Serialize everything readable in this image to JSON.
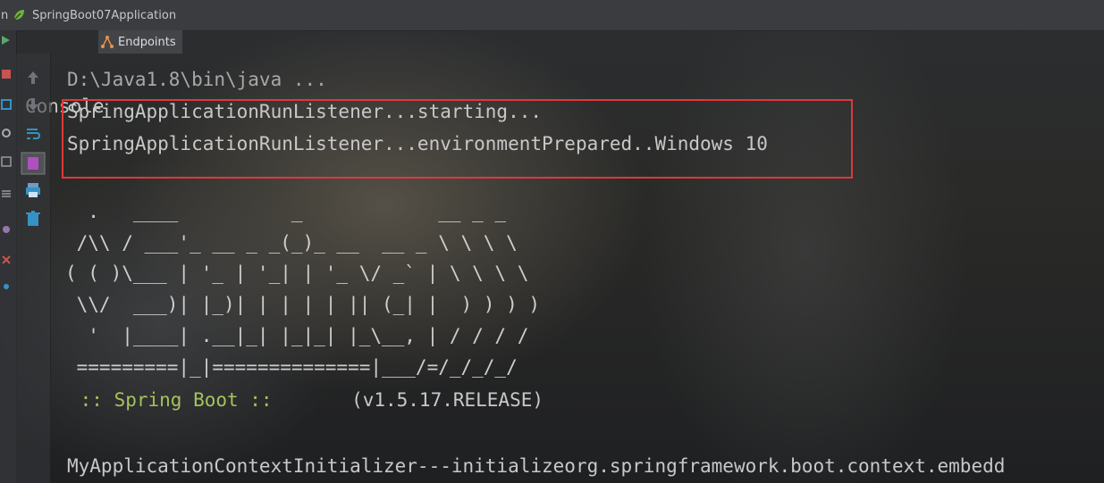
{
  "window": {
    "left_edge_text": "n",
    "title": "SpringBoot07Application"
  },
  "tabs": [
    {
      "label": "Console"
    },
    {
      "label": "Endpoints"
    }
  ],
  "console": {
    "command_line": "D:\\Java1.8\\bin\\java ...",
    "listener_lines": [
      "SpringApplicationRunListener...starting...",
      "SpringApplicationRunListener...environmentPrepared..Windows 10"
    ],
    "banner": [
      "  .   ____          _            __ _ _",
      " /\\\\ / ___'_ __ _ _(_)_ __  __ _ \\ \\ \\ \\",
      "( ( )\\___ | '_ | '_| | '_ \\/ _` | \\ \\ \\ \\",
      " \\\\/  ___)| |_)| | | | | || (_| |  ) ) ) )",
      "  '  |____| .__|_| |_|_| |_\\__, | / / / /",
      " =========|_|==============|___/=/_/_/_/"
    ],
    "spring_boot_label": " :: Spring Boot :: ",
    "spring_boot_version": "      (v1.5.17.RELEASE)",
    "initializer_line": "MyApplicationContextInitializer---initializeorg.springframework.boot.context.embedd"
  },
  "colors": {
    "highlight_border": "#e0383a",
    "spring_boot_green": "#a5c25c",
    "console_text": "#c8c8c8"
  },
  "icons": {
    "app": "spring-leaf-icon",
    "console_tab": "console-icon",
    "endpoints_tab": "endpoints-icon",
    "toolbar": [
      "up-arrow-icon",
      "down-arrow-icon",
      "soft-wrap-icon",
      "scroll-to-end-icon",
      "print-icon",
      "trash-icon"
    ]
  }
}
